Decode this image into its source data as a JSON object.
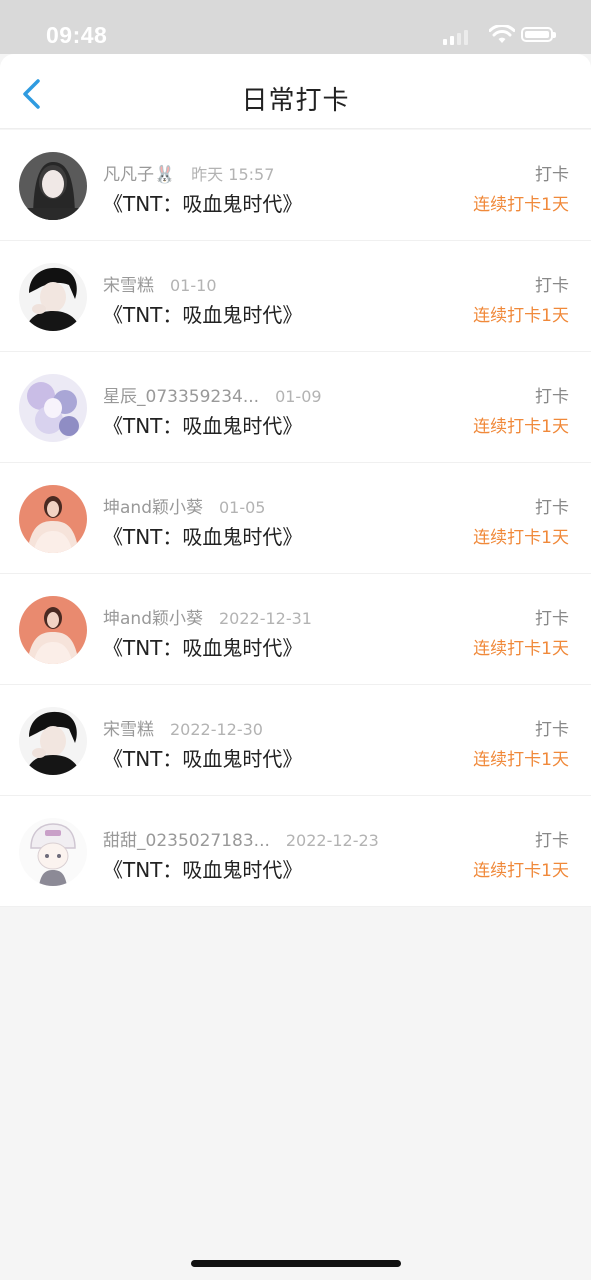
{
  "status": {
    "time": "09:48"
  },
  "header": {
    "title": "日常打卡"
  },
  "entries": [
    {
      "name": "凡凡子🐰",
      "date": "昨天 15:57",
      "book": "《TNT：吸血鬼时代》",
      "action": "打卡",
      "streak": "连续打卡1天",
      "avatar": "dark-portrait"
    },
    {
      "name": "宋雪糕",
      "date": "01-10",
      "book": "《TNT：吸血鬼时代》",
      "action": "打卡",
      "streak": "连续打卡1天",
      "avatar": "bw-portrait"
    },
    {
      "name": "星辰_073359234...",
      "date": "01-09",
      "book": "《TNT：吸血鬼时代》",
      "action": "打卡",
      "streak": "连续打卡1天",
      "avatar": "illustration"
    },
    {
      "name": "坤and颖小葵",
      "date": "01-05",
      "book": "《TNT：吸血鬼时代》",
      "action": "打卡",
      "streak": "连续打卡1天",
      "avatar": "pink-portrait"
    },
    {
      "name": "坤and颖小葵",
      "date": "2022-12-31",
      "book": "《TNT：吸血鬼时代》",
      "action": "打卡",
      "streak": "连续打卡1天",
      "avatar": "pink-portrait"
    },
    {
      "name": "宋雪糕",
      "date": "2022-12-30",
      "book": "《TNT：吸血鬼时代》",
      "action": "打卡",
      "streak": "连续打卡1天",
      "avatar": "bw-portrait"
    },
    {
      "name": "甜甜_0235027183...",
      "date": "2022-12-23",
      "book": "《TNT：吸血鬼时代》",
      "action": "打卡",
      "streak": "连续打卡1天",
      "avatar": "cartoon"
    }
  ],
  "colors": {
    "accent": "#f0893a",
    "back": "#2f9be0"
  }
}
